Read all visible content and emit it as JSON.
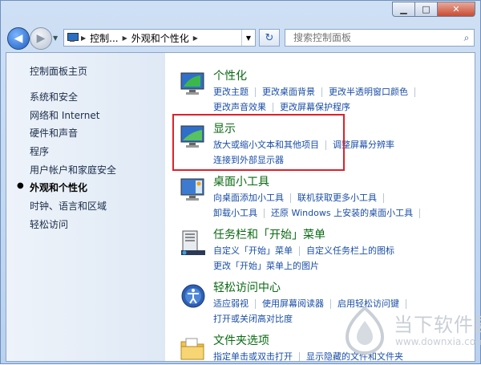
{
  "window": {
    "caption": {
      "minimize": "▁",
      "maximize": "□",
      "close": "✕"
    }
  },
  "navbar": {
    "back_label": "◀",
    "forward_label": "▶",
    "breadcrumbs": [
      "控制...",
      "外观和个性化"
    ],
    "refresh_label": "↻",
    "search_placeholder": "搜索控制面板"
  },
  "sidebar": {
    "items": [
      {
        "label": "控制面板主页",
        "current": false
      },
      {
        "label": "系统和安全",
        "current": false
      },
      {
        "label": "网络和 Internet",
        "current": false
      },
      {
        "label": "硬件和声音",
        "current": false
      },
      {
        "label": "程序",
        "current": false
      },
      {
        "label": "用户帐户和家庭安全",
        "current": false
      },
      {
        "label": "外观和个性化",
        "current": true
      },
      {
        "label": "时钟、语言和区域",
        "current": false
      },
      {
        "label": "轻松访问",
        "current": false
      }
    ]
  },
  "categories": [
    {
      "title": "个性化",
      "rows": [
        [
          "更改主题",
          "更改桌面背景",
          "更改半透明窗口颜色"
        ],
        [
          "更改声音效果",
          "更改屏幕保护程序"
        ]
      ]
    },
    {
      "title": "显示",
      "rows": [
        [
          "放大或缩小文本和其他项目",
          "调整屏幕分辨率"
        ],
        [
          "连接到外部显示器"
        ]
      ]
    },
    {
      "title": "桌面小工具",
      "rows": [
        [
          "向桌面添加小工具",
          "联机获取更多小工具"
        ],
        [
          "卸载小工具",
          "还原 Windows 上安装的桌面小工具"
        ]
      ]
    },
    {
      "title": "任务栏和「开始」菜单",
      "rows": [
        [
          "自定义「开始」菜单",
          "自定义任务栏上的图标"
        ],
        [
          "更改「开始」菜单上的图片"
        ]
      ]
    },
    {
      "title": "轻松访问中心",
      "rows": [
        [
          "适应弱视",
          "使用屏幕阅读器",
          "启用轻松访问键"
        ],
        [
          "打开或关闭高对比度"
        ]
      ]
    },
    {
      "title": "文件夹选项",
      "rows": [
        [
          "指定单击或双击打开",
          "显示隐藏的文件和文件夹"
        ]
      ]
    }
  ],
  "watermark": {
    "brand": "当下软件园",
    "url": "www.downxia.com"
  },
  "colors": {
    "category_title": "#0a6a12",
    "link": "#1a4ea6",
    "highlight_box": "#e0202a"
  }
}
